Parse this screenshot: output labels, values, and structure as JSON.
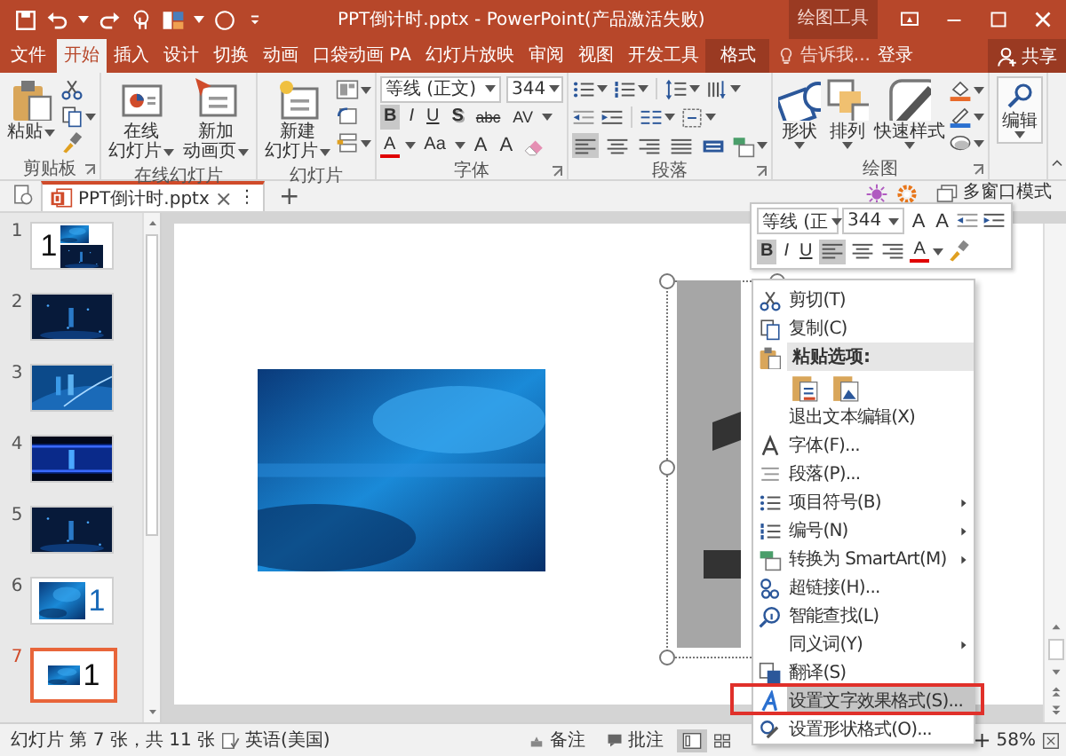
{
  "title_bar": {
    "title": "PPT倒计时.pptx - PowerPoint(产品激活失败)",
    "context_group": "绘图工具"
  },
  "tabs": [
    {
      "label": "文件",
      "selected": false,
      "kind": "file"
    },
    {
      "label": "开始",
      "selected": true,
      "kind": "normal"
    },
    {
      "label": "插入",
      "selected": false,
      "kind": "normal"
    },
    {
      "label": "设计",
      "selected": false,
      "kind": "normal"
    },
    {
      "label": "切换",
      "selected": false,
      "kind": "normal"
    },
    {
      "label": "动画",
      "selected": false,
      "kind": "normal"
    },
    {
      "label": "口袋动画 PA",
      "selected": false,
      "kind": "normal"
    },
    {
      "label": "幻灯片放映",
      "selected": false,
      "kind": "normal"
    },
    {
      "label": "审阅",
      "selected": false,
      "kind": "normal"
    },
    {
      "label": "视图",
      "selected": false,
      "kind": "normal"
    },
    {
      "label": "开发工具",
      "selected": false,
      "kind": "normal"
    },
    {
      "label": "格式",
      "selected": false,
      "kind": "context"
    }
  ],
  "tell_me": {
    "placeholder": "告诉我..."
  },
  "sign_in": "登录",
  "share": "共享",
  "ribbon": {
    "groups": [
      {
        "kind": "clipboard",
        "label": "剪贴板",
        "paste": "粘贴"
      },
      {
        "kind": "online",
        "label": "在线幻灯片",
        "buttons": [
          {
            "line1": "在线",
            "line2": "幻灯片"
          },
          {
            "line1": "新加",
            "line2": "动画页"
          }
        ]
      },
      {
        "kind": "slides",
        "label": "幻灯片",
        "new_slide": {
          "line1": "新建",
          "line2": "幻灯片"
        }
      },
      {
        "kind": "font",
        "label": "字体",
        "font": "等线 (正文)",
        "size": "344",
        "format_buttons": [
          {
            "label": "B",
            "kind": "bold",
            "selected": true
          },
          {
            "label": "I",
            "kind": "italic",
            "selected": false
          },
          {
            "label": "U",
            "kind": "underline",
            "selected": false
          },
          {
            "label": "S",
            "kind": "shadow",
            "selected": false
          },
          {
            "label": "abc",
            "kind": "strike",
            "selected": false
          },
          {
            "label": "AV",
            "kind": "spacing",
            "selected": false
          }
        ],
        "tools": [
          {
            "label": "A",
            "kind": "color"
          },
          {
            "label": "Aa",
            "kind": "case"
          },
          {
            "label": "A",
            "kind": "grow"
          },
          {
            "label": "A",
            "kind": "shrink"
          }
        ]
      },
      {
        "kind": "paragraph",
        "label": "段落",
        "align": [
          {
            "selected": true
          },
          {
            "selected": false
          },
          {
            "selected": false
          },
          {
            "selected": false
          },
          {
            "selected": false
          }
        ]
      },
      {
        "kind": "drawing",
        "label": "绘图",
        "buttons": [
          "形状",
          "排列",
          "快速样式"
        ]
      },
      {
        "kind": "editing",
        "button": "编辑"
      }
    ]
  },
  "document_tabs": {
    "tabs": [
      {
        "label": "PPT倒计时.pptx",
        "close": "×",
        "more": "⋮",
        "selected": true
      }
    ],
    "new_tab": "+",
    "multi_window": "多窗口模式"
  },
  "thumbnails": [
    {
      "number": "1",
      "text": "1",
      "selected": false,
      "kind": "title"
    },
    {
      "number": "2",
      "selected": false,
      "kind": "stars"
    },
    {
      "number": "3",
      "selected": false,
      "kind": "waves"
    },
    {
      "number": "4",
      "selected": false,
      "kind": "band"
    },
    {
      "number": "5",
      "selected": false,
      "kind": "stars"
    },
    {
      "number": "6",
      "text": "1",
      "selected": false,
      "kind": "side"
    },
    {
      "number": "7",
      "text": "1",
      "selected": true,
      "kind": "side"
    }
  ],
  "mini_toolbar": {
    "font": "等线 (正",
    "size": "344",
    "grow": "A",
    "shrink": "A",
    "format_buttons": [
      {
        "label": "B",
        "selected": true
      },
      {
        "label": "I",
        "selected": false
      },
      {
        "label": "U",
        "selected": false
      }
    ],
    "align": [
      {
        "selected": true
      },
      {
        "selected": false
      },
      {
        "selected": false
      }
    ],
    "color_button": "A"
  },
  "context_menu": [
    {
      "kind": "item",
      "label": "剪切(T)",
      "submenu": false,
      "selected": false
    },
    {
      "kind": "item",
      "label": "复制(C)",
      "submenu": false,
      "selected": false
    },
    {
      "kind": "header",
      "label": "粘贴选项:",
      "selected": false
    },
    {
      "kind": "paste_options",
      "selected": false
    },
    {
      "kind": "item",
      "label": "退出文本编辑(X)",
      "submenu": false,
      "selected": false
    },
    {
      "kind": "item",
      "label": "字体(F)...",
      "submenu": false,
      "selected": false
    },
    {
      "kind": "item",
      "label": "段落(P)...",
      "submenu": false,
      "selected": false
    },
    {
      "kind": "item",
      "label": "项目符号(B)",
      "submenu": true,
      "selected": false
    },
    {
      "kind": "item",
      "label": "编号(N)",
      "submenu": true,
      "selected": false
    },
    {
      "kind": "item",
      "label": "转换为 SmartArt(M)",
      "submenu": true,
      "selected": false
    },
    {
      "kind": "item",
      "label": "超链接(H)...",
      "submenu": false,
      "selected": false
    },
    {
      "kind": "item",
      "label": "智能查找(L)",
      "submenu": false,
      "selected": false
    },
    {
      "kind": "item",
      "label": "同义词(Y)",
      "submenu": true,
      "selected": false
    },
    {
      "kind": "item",
      "label": "翻译(S)",
      "submenu": false,
      "selected": false
    },
    {
      "kind": "item",
      "label": "设置文字效果格式(S)...",
      "submenu": false,
      "selected": true
    },
    {
      "kind": "item",
      "label": "设置形状格式(O)...",
      "submenu": false,
      "selected": false
    }
  ],
  "status_bar": {
    "slide_info": "幻灯片 第 7 张，共 11 张",
    "language": "英语(美国)",
    "notes": "备注",
    "comments": "批注",
    "zoom_in": "+",
    "zoom": "58%"
  }
}
